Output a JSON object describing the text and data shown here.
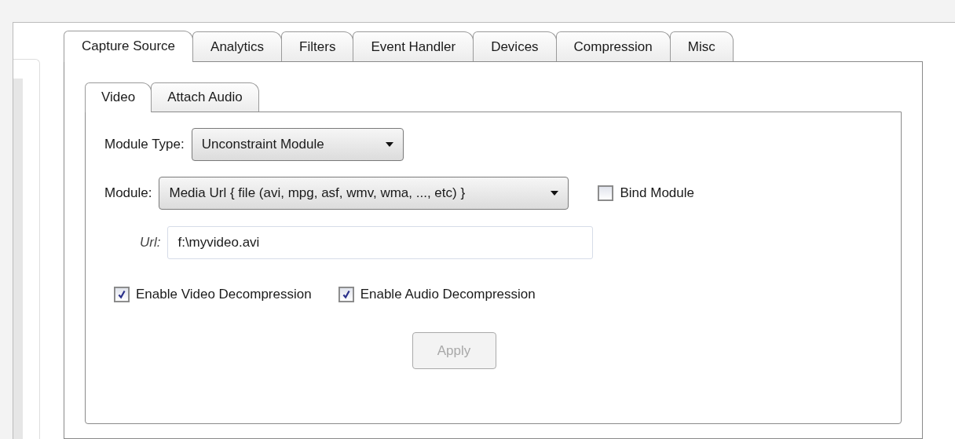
{
  "tabs": [
    {
      "label": "Capture Source",
      "selected": true
    },
    {
      "label": "Analytics",
      "selected": false
    },
    {
      "label": "Filters",
      "selected": false
    },
    {
      "label": "Event Handler",
      "selected": false
    },
    {
      "label": "Devices",
      "selected": false
    },
    {
      "label": "Compression",
      "selected": false
    },
    {
      "label": "Misc",
      "selected": false
    }
  ],
  "sub_tabs": [
    {
      "label": "Video",
      "selected": true
    },
    {
      "label": "Attach Audio",
      "selected": false
    }
  ],
  "module_type": {
    "label": "Module Type:",
    "value": "Unconstraint Module"
  },
  "module": {
    "label": "Module:",
    "value": "Media Url { file (avi, mpg, asf, wmv, wma, ..., etc) }"
  },
  "bind_module": {
    "label": "Bind Module",
    "checked": false
  },
  "url": {
    "label": "Url:",
    "value": "f:\\myvideo.avi"
  },
  "options": [
    {
      "label": "Enable Video Decompression",
      "checked": true
    },
    {
      "label": "Enable Audio Decompression",
      "checked": true
    }
  ],
  "apply": {
    "label": "Apply",
    "disabled": true
  }
}
